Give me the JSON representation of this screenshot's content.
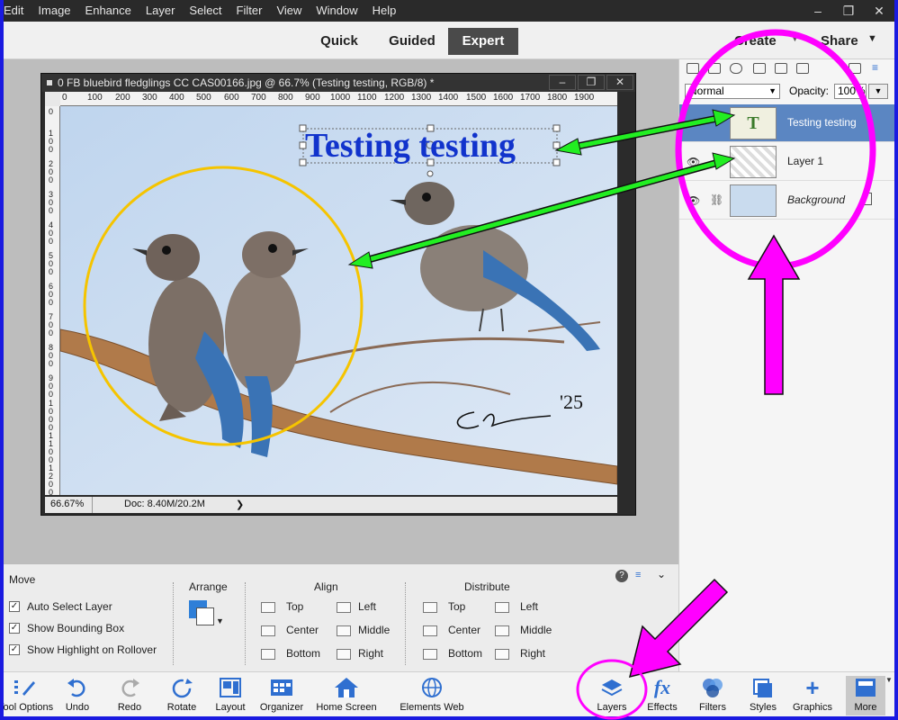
{
  "menu": [
    "Edit",
    "Image",
    "Enhance",
    "Layer",
    "Select",
    "Filter",
    "View",
    "Window",
    "Help"
  ],
  "window_controls": [
    "–",
    "❐",
    "✕"
  ],
  "modes": {
    "quick": "Quick",
    "guided": "Guided",
    "expert": "Expert"
  },
  "header": {
    "create": "Create",
    "share": "Share"
  },
  "document": {
    "title": "0 FB bluebird fledglings CC CAS00166.jpg @ 66.7% (Testing testing, RGB/8) *",
    "zoom": "66.67%",
    "doc_size": "Doc: 8.40M/20.2M",
    "status_arrow": "❯",
    "ruler_h": [
      "0",
      "100",
      "200",
      "300",
      "400",
      "500",
      "600",
      "700",
      "800",
      "900",
      "1000",
      "1100",
      "1200",
      "1300",
      "1400",
      "1500",
      "1600",
      "1700",
      "1800",
      "1900"
    ],
    "ruler_v": [
      "0",
      "100",
      "200",
      "300",
      "400",
      "500",
      "600",
      "700",
      "800",
      "900",
      "1000",
      "1100",
      "1200"
    ],
    "canvas_text": "Testing testing",
    "signature": "'25"
  },
  "tool_options": {
    "tool_name": "Move",
    "checkboxes": [
      "Auto Select Layer",
      "Show Bounding Box",
      "Show Highlight on Rollover"
    ],
    "arrange": "Arrange",
    "align": "Align",
    "align_col1": [
      "Top",
      "Center",
      "Bottom"
    ],
    "align_col2": [
      "Left",
      "Middle",
      "Right"
    ],
    "distribute": "Distribute",
    "dist_col1": [
      "Top",
      "Center",
      "Bottom"
    ],
    "dist_col2": [
      "Left",
      "Middle",
      "Right"
    ]
  },
  "layers_panel": {
    "blend_mode": "Normal",
    "opacity_label": "Opacity:",
    "opacity_value": "100%",
    "layers": [
      {
        "name": "Testing testing",
        "type": "text",
        "selected": true
      },
      {
        "name": "Layer 1",
        "type": "image",
        "selected": false
      },
      {
        "name": "Background",
        "type": "image",
        "selected": false
      }
    ]
  },
  "taskbar": {
    "left": [
      "Tool Options",
      "Undo",
      "Redo",
      "Rotate",
      "Layout",
      "Organizer",
      "Home Screen",
      "Elements Web"
    ],
    "right": [
      "Layers",
      "Effects",
      "Filters",
      "Styles",
      "Graphics",
      "More"
    ]
  },
  "colors": {
    "annotation_magenta": "#ff00ff",
    "annotation_green": "#22ee22",
    "circle_yellow": "#f5c400",
    "canvas_text_blue": "#1133cc",
    "selected_layer": "#5b86c2",
    "window_frame": "#1a1ae0"
  }
}
